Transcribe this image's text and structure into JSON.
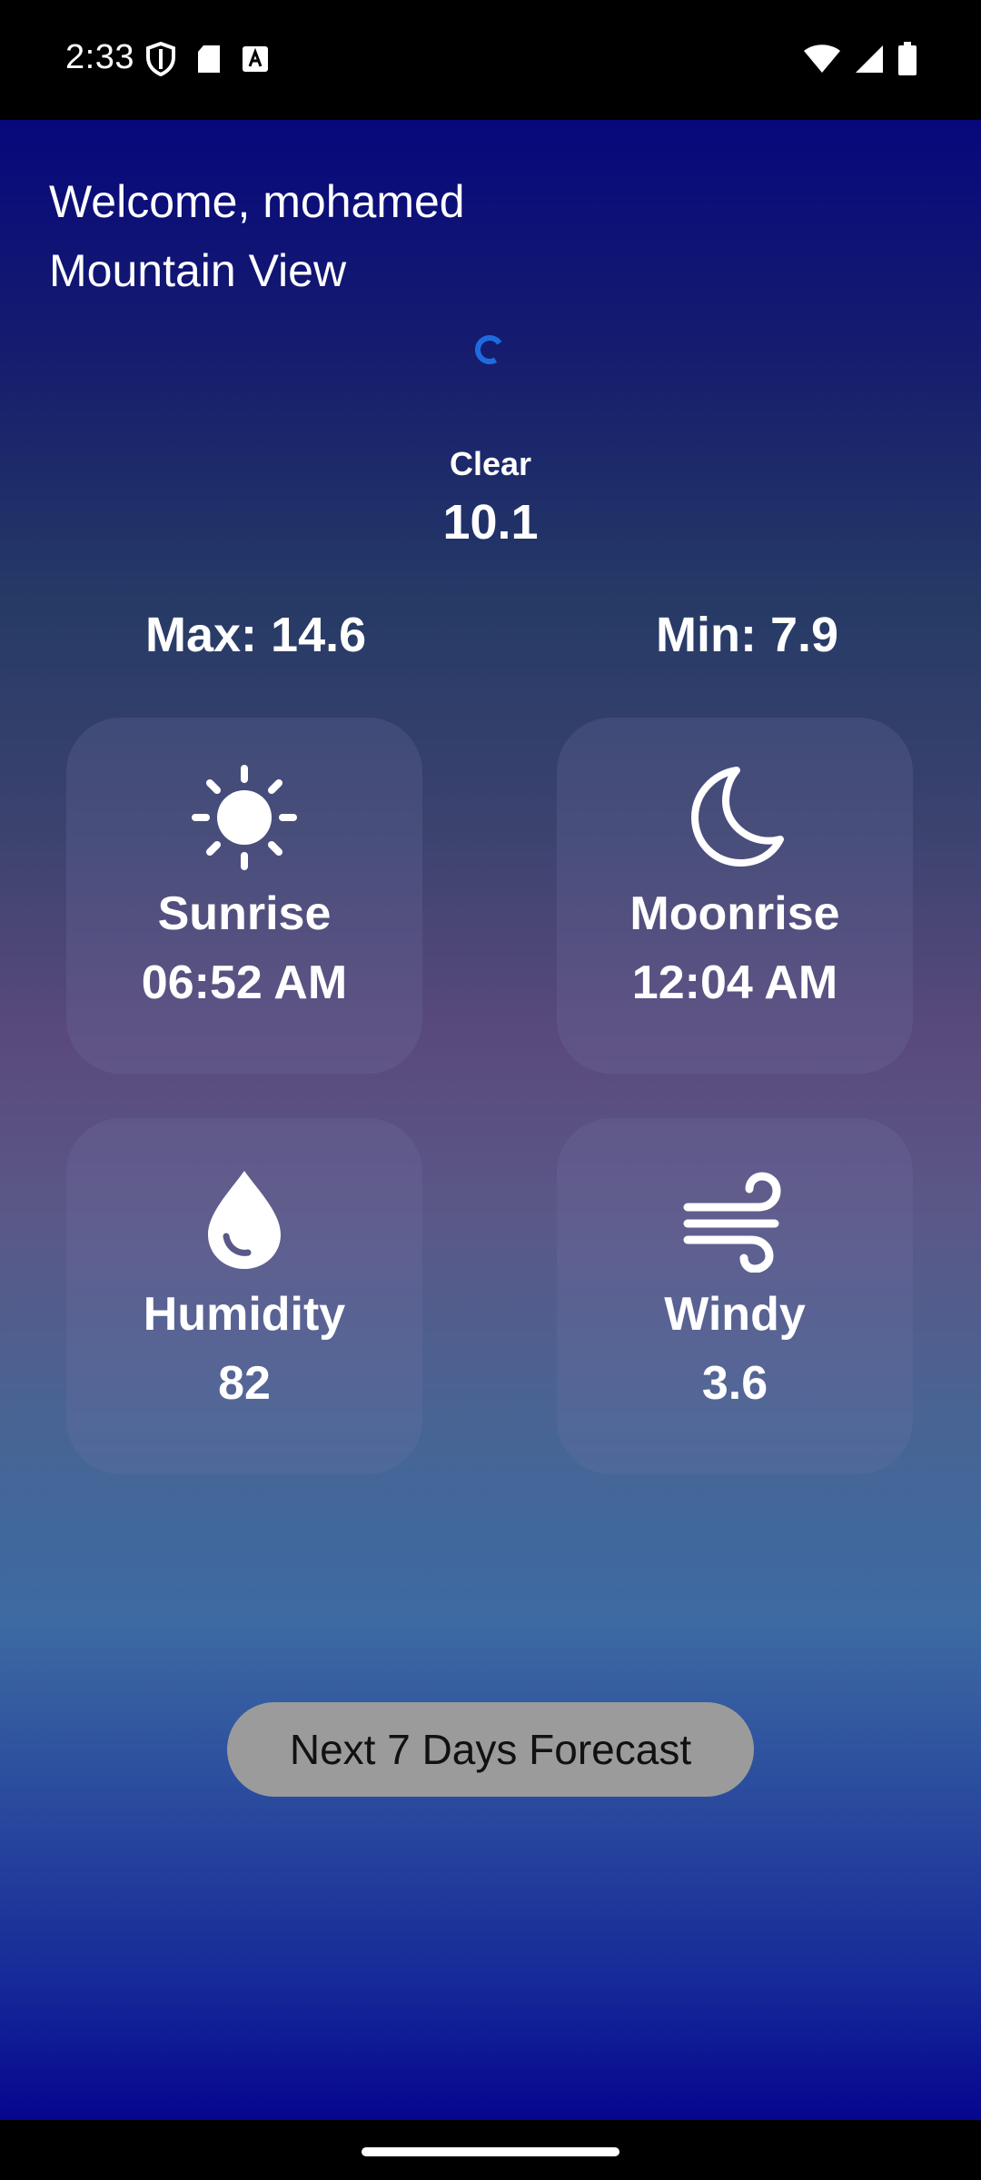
{
  "status_bar": {
    "time": "2:33",
    "left_icons": [
      "shield-icon",
      "sd-card-icon",
      "text-a-icon"
    ],
    "right_icons": [
      "wifi-icon",
      "cell-signal-icon",
      "battery-icon"
    ]
  },
  "header": {
    "welcome": "Welcome, mohamed",
    "location": "Mountain View"
  },
  "weather": {
    "condition": "Clear",
    "temperature": "10.1",
    "max": "Max: 14.6",
    "min": "Min: 7.9"
  },
  "cards": [
    {
      "icon": "sun-icon",
      "label": "Sunrise",
      "value": "06:52 AM"
    },
    {
      "icon": "moon-icon",
      "label": "Moonrise",
      "value": "12:04 AM"
    },
    {
      "icon": "water-drop-icon",
      "label": "Humidity",
      "value": "82"
    },
    {
      "icon": "wind-icon",
      "label": "Windy",
      "value": "3.6"
    }
  ],
  "forecast_button_label": "Next 7 Days Forecast",
  "colors": {
    "background_top": "#07087c",
    "background_mid": "#5a4a7c",
    "background_bottom": "#06068e",
    "button": "#9b9b9b",
    "loader": "#1e6be0"
  }
}
